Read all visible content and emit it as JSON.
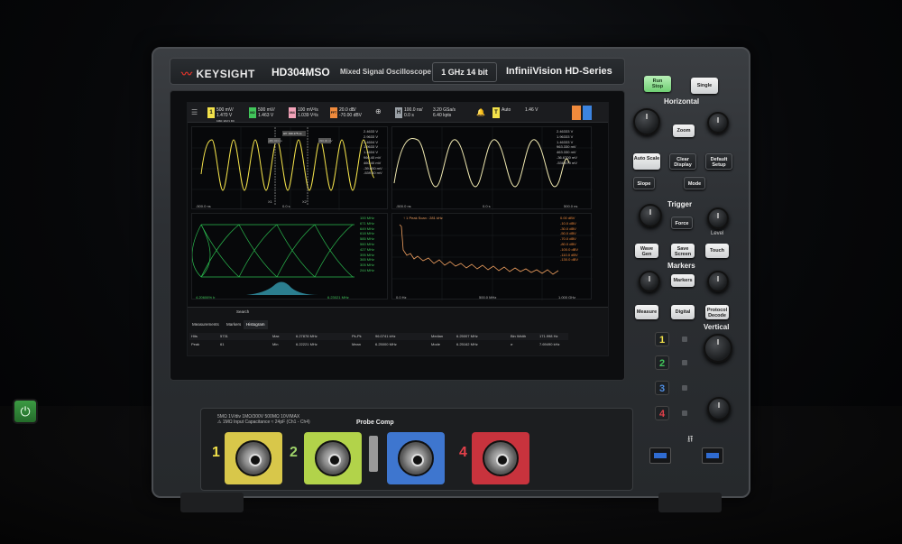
{
  "brand": {
    "name": "KEYSIGHT",
    "model": "HD304MSO",
    "model_desc": "Mixed Signal Oscilloscope",
    "spec": "1 GHz  14 bit",
    "series": "InfiniiVision  HD-Series"
  },
  "topbar": {
    "channels": [
      {
        "num": "1",
        "line1": "500 mV/",
        "line2": "1.470 V",
        "line3": "1MΩ  1kV/1  DC",
        "color": "#f2e14a"
      },
      {
        "num": "M2",
        "line1": "500 mV/",
        "line2": "1.463 V",
        "line3": "",
        "color": "#41c55a"
      },
      {
        "num": "M4",
        "line1": "100 mV²/s",
        "line2": "1.039 V²/s",
        "line3": "",
        "color": "#f2a2b8"
      },
      {
        "num": "FFT",
        "line1": "20.0 dB/",
        "line2": "-70.00 dBV",
        "line3": "",
        "color": "#f08a3c"
      }
    ],
    "horizontal": {
      "tag": "H",
      "line1": "100.0 ns/",
      "line2": "0.0 s"
    },
    "acq": {
      "line1": "3.20 GSa/s",
      "line2": "6.40 kpts"
    },
    "trigger": {
      "tag": "T",
      "line1": "Auto",
      "level": "1.46 V"
    }
  },
  "pane1": {
    "scale": [
      "2.4633 V",
      "2.9633 V",
      "2.4604 V",
      "1.9633 V",
      "1.4604 V",
      "960.40 mV",
      "460.40 mV",
      "-39.600 mV",
      "-539.60 mV"
    ],
    "xmin": "-500.0 ns",
    "xmid": "0.0 s",
    "markers": [
      "X1",
      "X2"
    ],
    "tags": [
      "-480.023 ns",
      "ΔX: 190.175 ns",
      "-390.00 mV"
    ]
  },
  "pane2": {
    "scale": [
      "2.46333 V",
      "1.96333 V",
      "1.46333 V",
      "963.330 mV",
      "463.330 mV",
      "-36.6700 mV",
      "-536.670 mV"
    ],
    "xmin": "-500.0 ns",
    "xmid": "0.0 s",
    "xmax": "500.0 ns"
  },
  "pane3": {
    "scale": [
      "100 MHz",
      "671 MHz",
      "649 MHz",
      "618 MHz",
      "585 MHz",
      "560 MHz",
      "427 MHz",
      "395 MHz",
      "365 MHz",
      "305 MHz",
      "244 MHz"
    ],
    "xmin": "4.20606% b",
    "xmax": "6.23021 MHz"
  },
  "pane4": {
    "scale": [
      "0.00 dBV",
      "-10.0 dBV",
      "-30.0 dBV",
      "-50.0 dBV",
      "-70.0 dBV",
      "-80.0 dBV",
      "-100.0 dBV",
      "-110.0 dBV",
      "-130.0 dBV"
    ],
    "xmin": "0.0 Hz",
    "xmid": "500.0 MHz",
    "xmax": "1.000 GHz",
    "annotation": "↑ 1 Peak Scan : 281 kHz"
  },
  "bottom": {
    "search": "Search",
    "tabs": [
      "Measurements",
      "Markers",
      "Histogram"
    ],
    "rows": [
      [
        "Hits",
        "5731",
        "Max",
        "6.27878 MHz",
        "Pk-Pk",
        "96.0741 kHz",
        "Median",
        "6.25007 MHz",
        "Bin Width",
        "171.998 Hz"
      ],
      [
        "Peak",
        "61",
        "Min",
        "6.22221 MHz",
        "Mean",
        "6.25000 MHz",
        "Mode",
        "6.25162 MHz",
        "σ",
        "7.69490 kHz"
      ]
    ]
  },
  "controls": {
    "run_stop": "Run\nStop",
    "single": "Single",
    "horizontal": "Horizontal",
    "zoom": "Zoom",
    "auto_scale": "Auto Scale",
    "clear_display": "Clear Display",
    "default_setup": "Default Setup",
    "slope": "Slope",
    "mode": "Mode",
    "trigger": "Trigger",
    "force": "Force",
    "level": "Level",
    "wave_gen": "Wave Gen",
    "save_screen": "Save Screen",
    "touch": "Touch",
    "markers": "Markers",
    "markers_btn": "Markers",
    "measure": "Measure",
    "digital": "Digital",
    "protocol_decode": "Protocol Decode",
    "vertical": "Vertical",
    "channels": [
      "1",
      "2",
      "3",
      "4"
    ],
    "channel_colors": [
      "#f2e14a",
      "#41c55a",
      "#4f8de0",
      "#e2404a"
    ]
  },
  "front": {
    "note1": "5MΩ 1V/div  1MΩ/300V 500MΩ 10V/MAX",
    "note2": "⚠ 1MΩ Input Capacitance ≈ 24pF (Ch1 - Ch4)",
    "probe_comp": "Probe Comp",
    "channels": [
      "1",
      "2",
      "3",
      "4"
    ]
  }
}
